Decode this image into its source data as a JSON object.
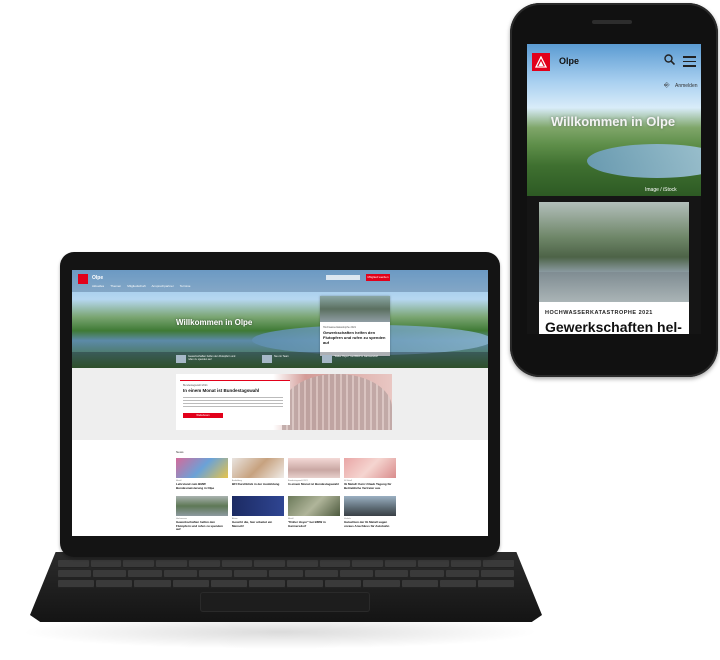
{
  "colors": {
    "brand": "#e2001a",
    "device": "#141414"
  },
  "laptop": {
    "site_name": "Olpe",
    "nav": [
      "Aktuelles",
      "Themen",
      "Mitgliedschaft",
      "Ansprechpartner",
      "Termine"
    ],
    "search_placeholder": "Suche",
    "join_label": "Mitglied werden",
    "hero_title": "Willkommen in Olpe",
    "hero_card": {
      "kicker": "Hochwasserkatastrophe 2021",
      "title": "Gewerkschaften helfen den Flutopfern und rufen zu spenden auf"
    },
    "hero_strip": [
      "Gewerkschaften helfen den Flutopfern und rufen zu spenden auf",
      "Neu im Team",
      "\"Roller Hoyer\" bei BMW in Garmersdorf"
    ],
    "feature": {
      "kicker": "Bundestagswahl 2021",
      "title": "In einem Monat ist Bundestagswahl",
      "button": "Weiterlesen"
    },
    "news_label": "News",
    "news": [
      {
        "kicker": "Metall",
        "title": "Lehrstand zum BMW Bundesmeisterung in Olpe"
      },
      {
        "kicker": "Ausbildung",
        "title": "BFI Durchblick in der Ausbildung"
      },
      {
        "kicker": "Bundestagswahl 2021",
        "title": "In einem Monat ist Bundestagswahl"
      },
      {
        "kicker": "IG Metall",
        "title": "IG Metall: Kein Urlaub Tagung für Betriebliche Vertreter aus"
      },
      {
        "kicker": "Hochwasser",
        "title": "Gewerkschaften helfen den Flutopfern und rufen zu spenden auf"
      },
      {
        "kicker": "Aktion",
        "title": "Gesicht die, hier arbeitet ein Mensch!"
      },
      {
        "kicker": "Metall",
        "title": "\"Roller Hoyer\" bei BMW in Garmersdorf"
      },
      {
        "kicker": "Verkehr",
        "title": "Gutachten der IG Metall sagen voraus Anschluss für Autobahn"
      }
    ]
  },
  "phone": {
    "site_name": "Olpe",
    "login_label": "Anmelden",
    "hero_title": "Willkommen in Olpe",
    "photo_credit": "Image / iStock",
    "card_kicker": "HOCHWASSERKATASTROPHE 2021",
    "card_title": "Gewerkschaften hel-"
  }
}
